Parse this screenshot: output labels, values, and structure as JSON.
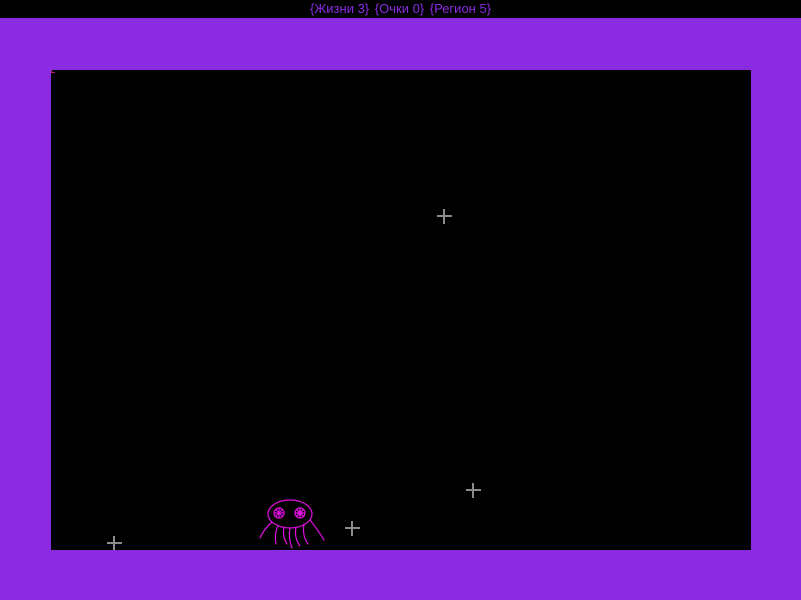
{
  "hud": {
    "lives": "{Жизни 3}",
    "score": "{Очки 0}",
    "region": "{Регион 5}"
  },
  "colors": {
    "frame": "#8a2be2",
    "field": "#000000",
    "player": "#e10ee1",
    "star": "#8c8c8c"
  },
  "sprites": {
    "player": "jellyfish-icon",
    "stars": [
      "plus-star-icon",
      "plus-star-icon",
      "plus-star-icon",
      "plus-star-icon"
    ]
  }
}
